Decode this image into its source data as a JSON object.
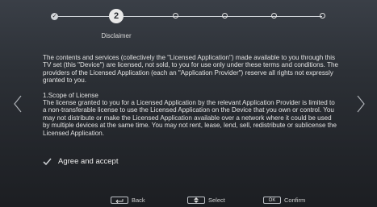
{
  "stepper": {
    "done_mark": "✓",
    "current_step": "2",
    "current_caption": "Disclaimer",
    "total_steps": 6
  },
  "body": {
    "intro": "The contents and services (collectively the \"Licensed Application\") made available to you through this TV set (this \"Device\") are licensed, not sold, to you for use only under these terms and conditions. The providers of the Licensed Application (each an \"Application Provider\") reserve all rights not expressly granted to you.",
    "section_title": "1.Scope of License",
    "section_text": "The license granted to you for a Licensed Application by the relevant Application Provider is limited to a non-transferable license to use the Licensed Application on the Device that you own or control. You may not distribute or make the Licensed Application available over a network where it could be used by multiple devices at the same time. You may not rent, lease, lend, sell, redistribute or sublicense the Licensed Application."
  },
  "agree": {
    "label": "Agree and accept",
    "checked": true
  },
  "footer": {
    "back_label": "Back",
    "select_label": "Select",
    "ok_key": "OK",
    "confirm_label": "Confirm"
  },
  "icons": {
    "prev": "chevron-left-icon",
    "next": "chevron-right-icon",
    "check": "checkmark-icon",
    "back": "return-arrow-icon",
    "select": "up-down-arrow-icon"
  }
}
